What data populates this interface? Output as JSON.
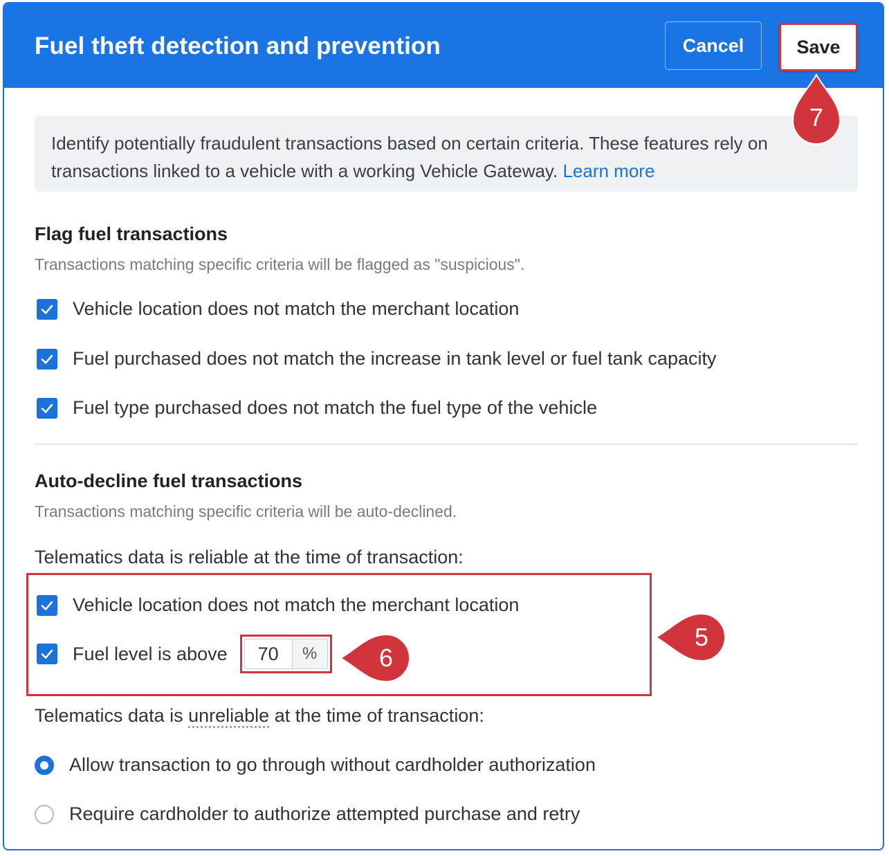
{
  "dialog": {
    "title": "Fuel theft detection and prevention",
    "cancel_label": "Cancel",
    "save_label": "Save"
  },
  "info": {
    "text": "Identify potentially fraudulent transactions based on certain criteria. These features rely on transactions linked to a vehicle with a working Vehicle Gateway. ",
    "link": "Learn more"
  },
  "flag": {
    "title": "Flag fuel transactions",
    "subtitle": "Transactions matching specific criteria will be flagged as \"suspicious\".",
    "items": [
      {
        "label": "Vehicle location does not match the merchant location",
        "checked": true
      },
      {
        "label": "Fuel purchased does not match the increase in tank level or fuel tank capacity",
        "checked": true
      },
      {
        "label": "Fuel type purchased does not match the fuel type of the vehicle",
        "checked": true
      }
    ]
  },
  "decline": {
    "title": "Auto-decline fuel transactions",
    "subtitle": "Transactions matching specific criteria will be auto-declined.",
    "reliable_label": "Telematics data is reliable at the time of transaction:",
    "reliable_items": [
      {
        "label": "Vehicle location does not match the merchant location",
        "checked": true
      },
      {
        "label": "Fuel level is above",
        "checked": true
      }
    ],
    "fuel_level_value": "70",
    "fuel_level_unit": "%",
    "unreliable_prefix": "Telematics data is ",
    "unreliable_word": "unreliable",
    "unreliable_suffix": " at the time of transaction:",
    "options": [
      {
        "label": "Allow transaction to go through without cardholder authorization",
        "selected": true
      },
      {
        "label": "Require cardholder to authorize attempted purchase and retry",
        "selected": false
      }
    ]
  },
  "callouts": {
    "five": "5",
    "six": "6",
    "seven": "7"
  },
  "colors": {
    "header_blue": "#1b74e4",
    "accent_blue": "#1b73d9",
    "callout_red": "#d2343c"
  }
}
